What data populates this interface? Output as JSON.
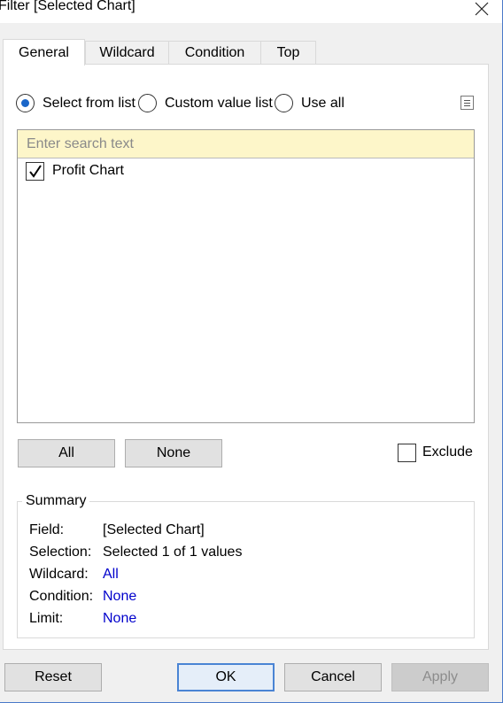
{
  "window": {
    "title": "Filter [Selected Chart]"
  },
  "tabs": [
    {
      "label": "General",
      "active": true
    },
    {
      "label": "Wildcard",
      "active": false
    },
    {
      "label": "Condition",
      "active": false
    },
    {
      "label": "Top",
      "active": false
    }
  ],
  "mode": {
    "options": [
      "Select from list",
      "Custom value list",
      "Use all"
    ],
    "selected": "Select from list"
  },
  "search": {
    "placeholder": "Enter search text",
    "value": ""
  },
  "list": {
    "items": [
      {
        "label": "Profit Chart",
        "checked": true
      }
    ]
  },
  "buttons": {
    "all": "All",
    "none": "None"
  },
  "exclude": {
    "label": "Exclude",
    "checked": false
  },
  "summary": {
    "title": "Summary",
    "rows": [
      {
        "key": "Field:",
        "value": "[Selected Chart]",
        "link": false
      },
      {
        "key": "Selection:",
        "value": "Selected 1 of 1 values",
        "link": false
      },
      {
        "key": "Wildcard:",
        "value": "All",
        "link": true
      },
      {
        "key": "Condition:",
        "value": "None",
        "link": true
      },
      {
        "key": "Limit:",
        "value": "None",
        "link": true
      }
    ]
  },
  "footer": {
    "reset": "Reset",
    "ok": "OK",
    "cancel": "Cancel",
    "apply": "Apply"
  },
  "colors": {
    "accent": "#1a66c9",
    "link": "#0000cc",
    "search_bg": "#fdf6c9",
    "dialog_bg": "#f0f0f0"
  }
}
